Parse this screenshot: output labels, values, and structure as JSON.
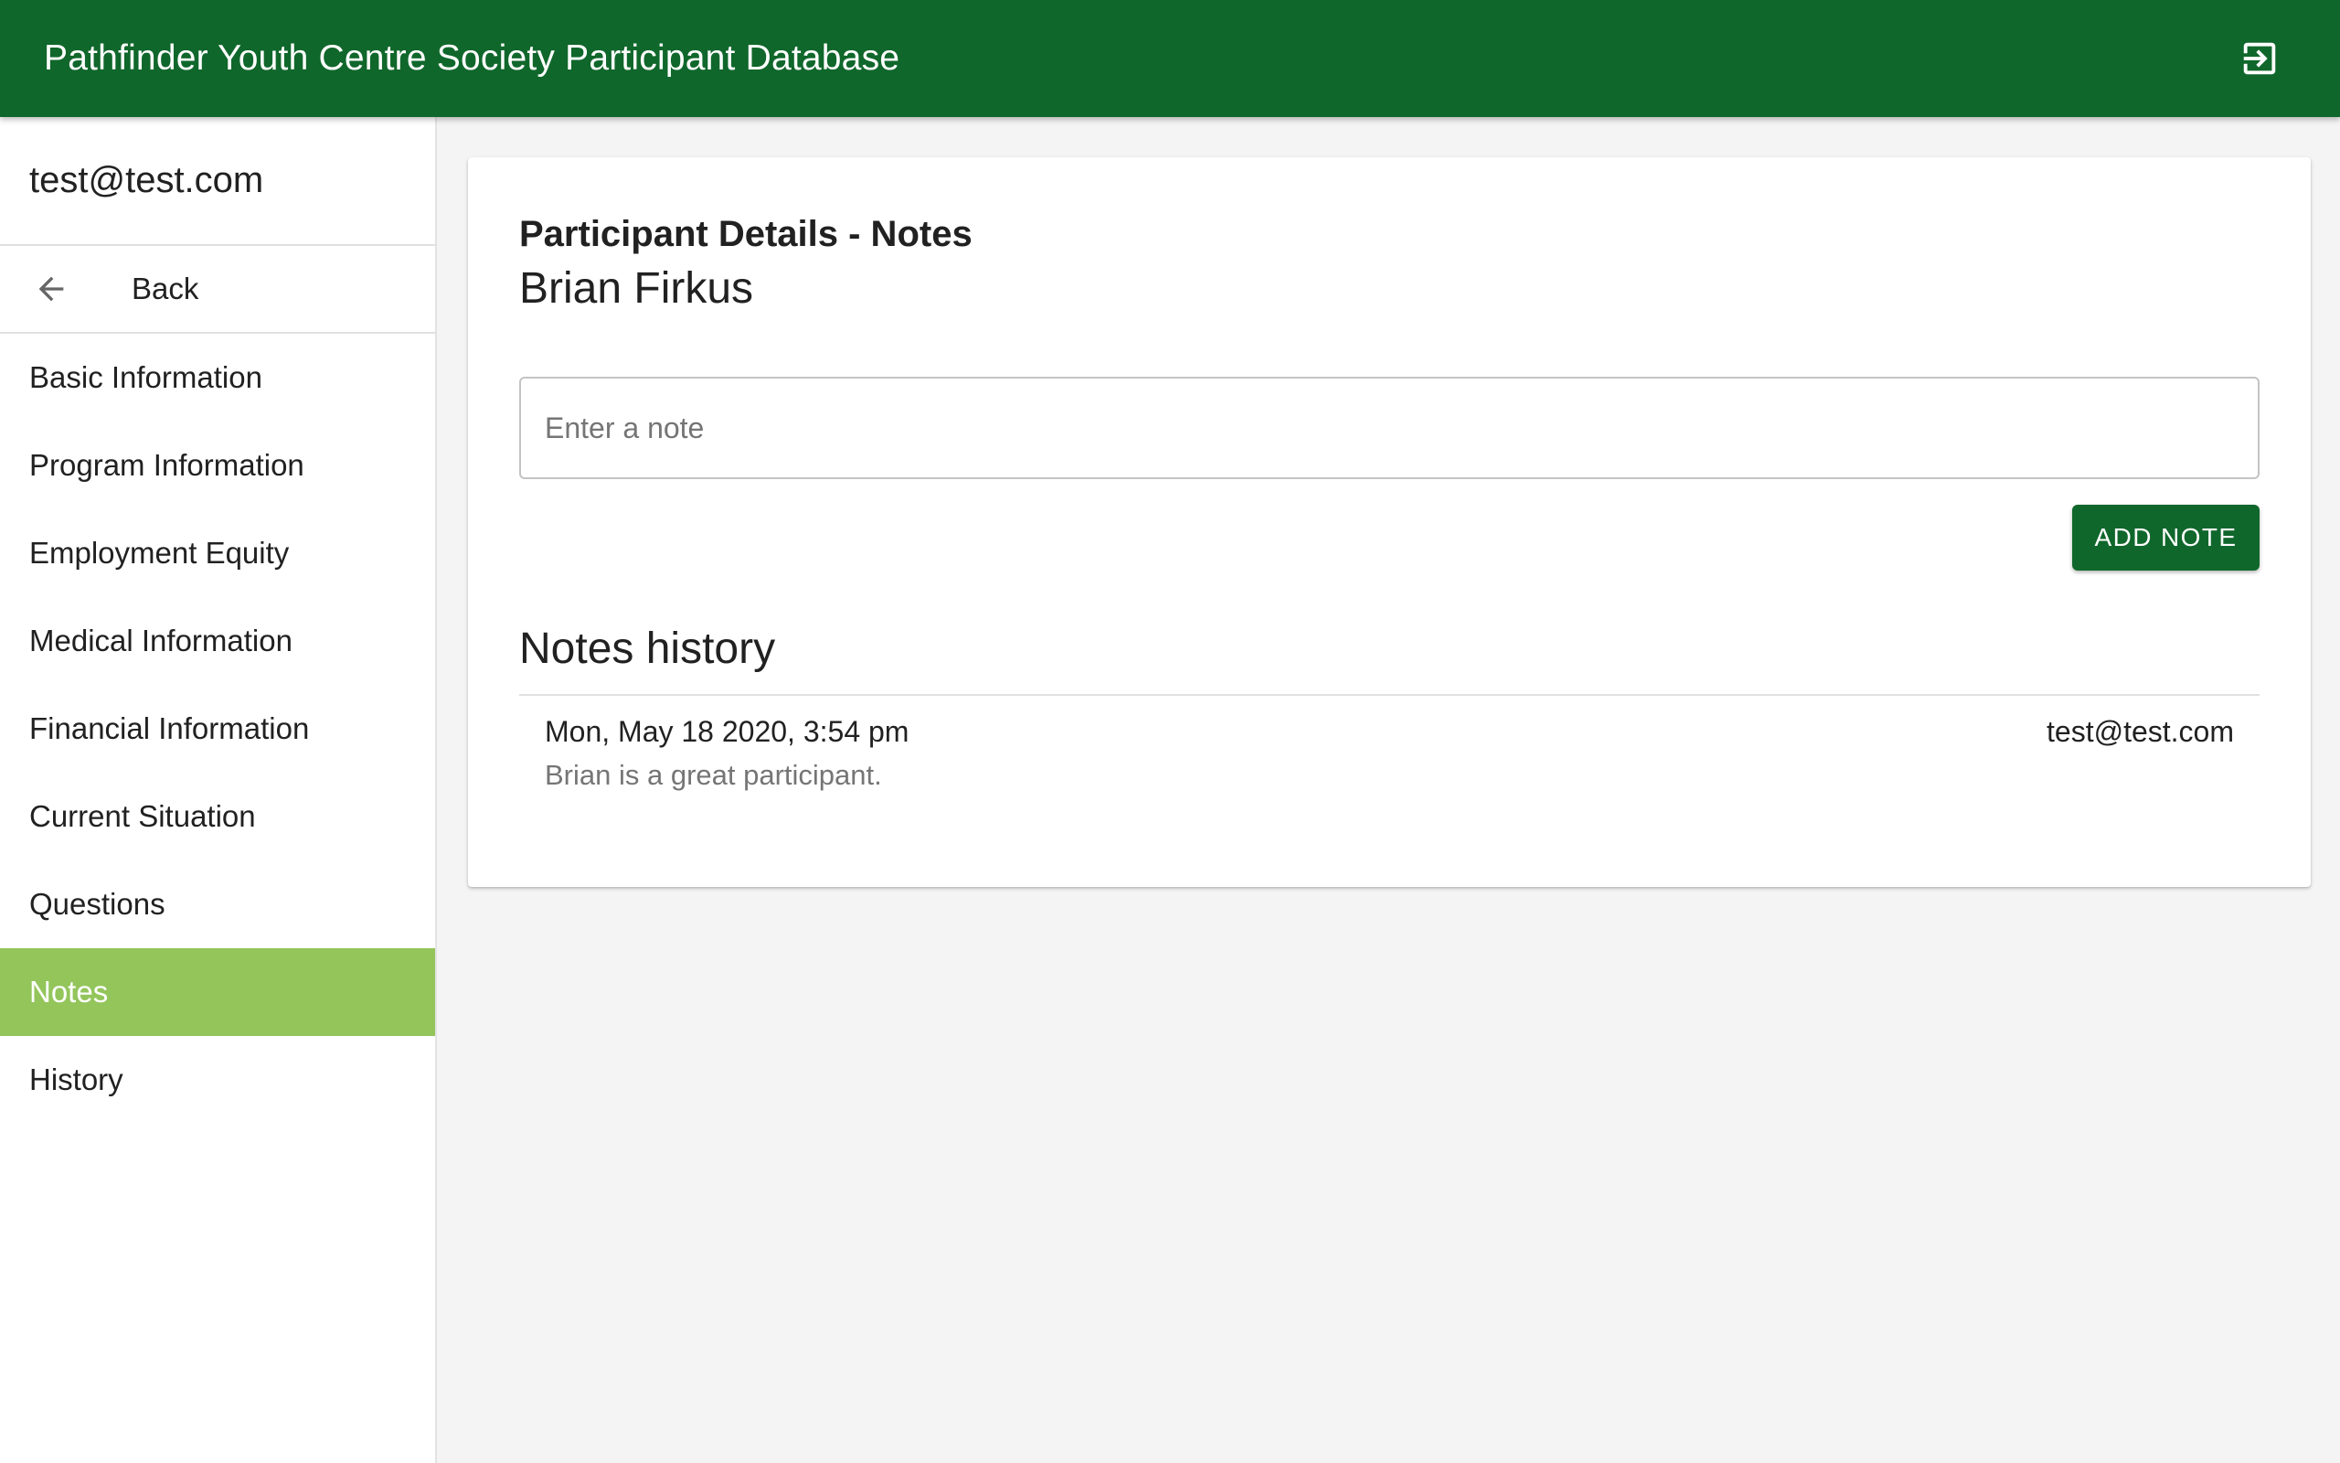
{
  "header": {
    "title": "Pathfinder Youth Centre Society Participant Database",
    "logout_icon": "logout-icon"
  },
  "sidebar": {
    "user": "test@test.com",
    "back_label": "Back",
    "back_icon": "arrow-left-icon",
    "items": [
      {
        "label": "Basic Information",
        "active": false
      },
      {
        "label": "Program Information",
        "active": false
      },
      {
        "label": "Employment Equity",
        "active": false
      },
      {
        "label": "Medical Information",
        "active": false
      },
      {
        "label": "Financial Information",
        "active": false
      },
      {
        "label": "Current Situation",
        "active": false
      },
      {
        "label": "Questions",
        "active": false
      },
      {
        "label": "Notes",
        "active": true
      },
      {
        "label": "History",
        "active": false
      }
    ]
  },
  "main": {
    "heading": "Participant Details - Notes",
    "participant_name": "Brian Firkus",
    "note_input": {
      "placeholder": "Enter a note",
      "value": ""
    },
    "add_button_label": "ADD NOTE",
    "history_title": "Notes history",
    "notes": [
      {
        "date": "Mon, May 18 2020, 3:54 pm",
        "author": "test@test.com",
        "text": "Brian is a great participant."
      }
    ]
  },
  "colors": {
    "primary": "#10672b",
    "active_nav": "#93c55b",
    "background": "#f4f4f4"
  }
}
